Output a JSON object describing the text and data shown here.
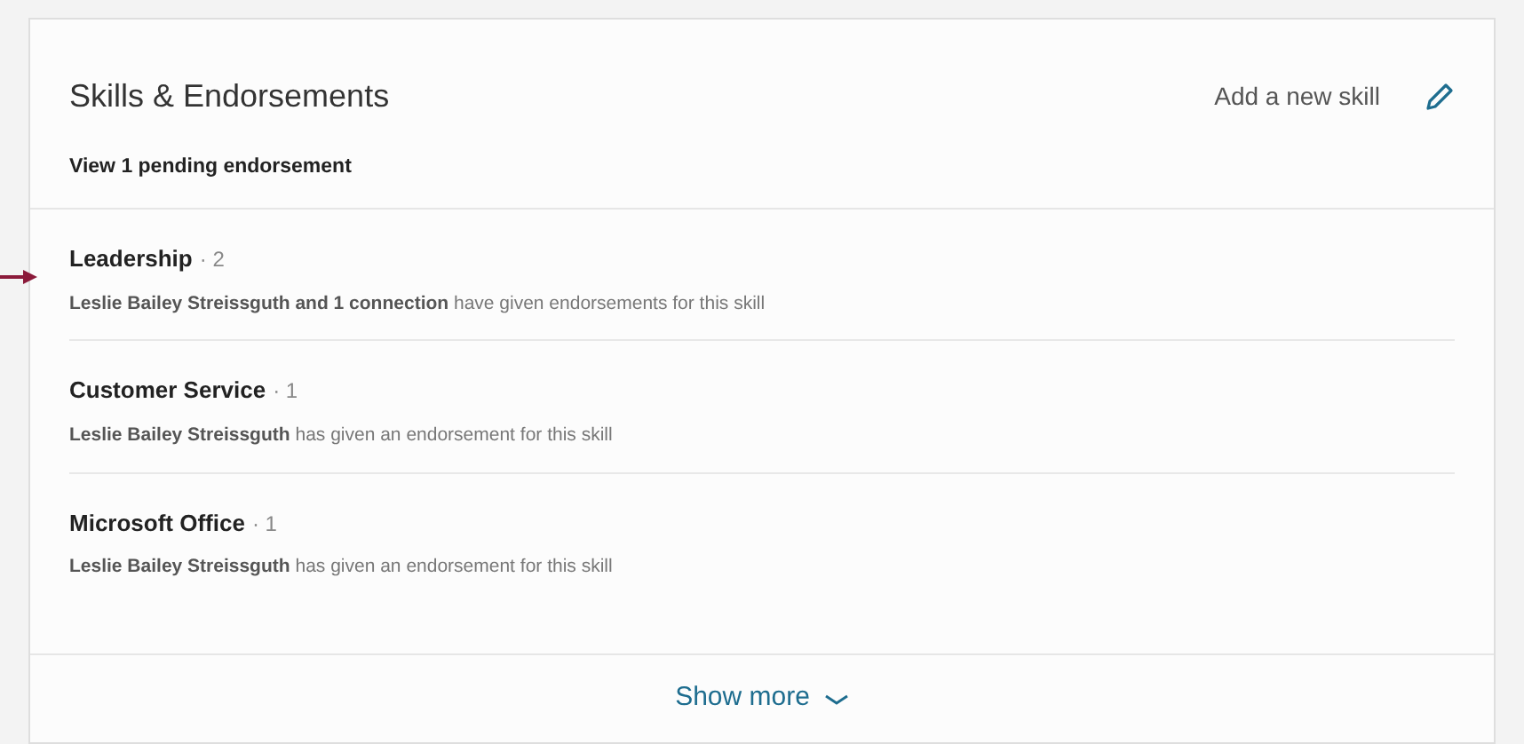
{
  "section": {
    "title": "Skills & Endorsements",
    "add_link": "Add a new skill",
    "pending": "View 1 pending endorsement"
  },
  "skills": [
    {
      "name": "Leadership",
      "count": "· 2",
      "endorsers": "**Leslie Bailey Streissguth and 1 connection** have given endorsements for this skill",
      "pointed": true
    },
    {
      "name": "Customer Service",
      "count": "· 1",
      "endorsers": "**Leslie Bailey Streissguth** has given an endorsement for this skill",
      "pointed": false
    },
    {
      "name": "Microsoft Office",
      "count": "· 1",
      "endorsers": "**Leslie Bailey Streissguth** has given an endorsement for this skill",
      "pointed": false
    }
  ],
  "footer": {
    "label": "Show more"
  }
}
